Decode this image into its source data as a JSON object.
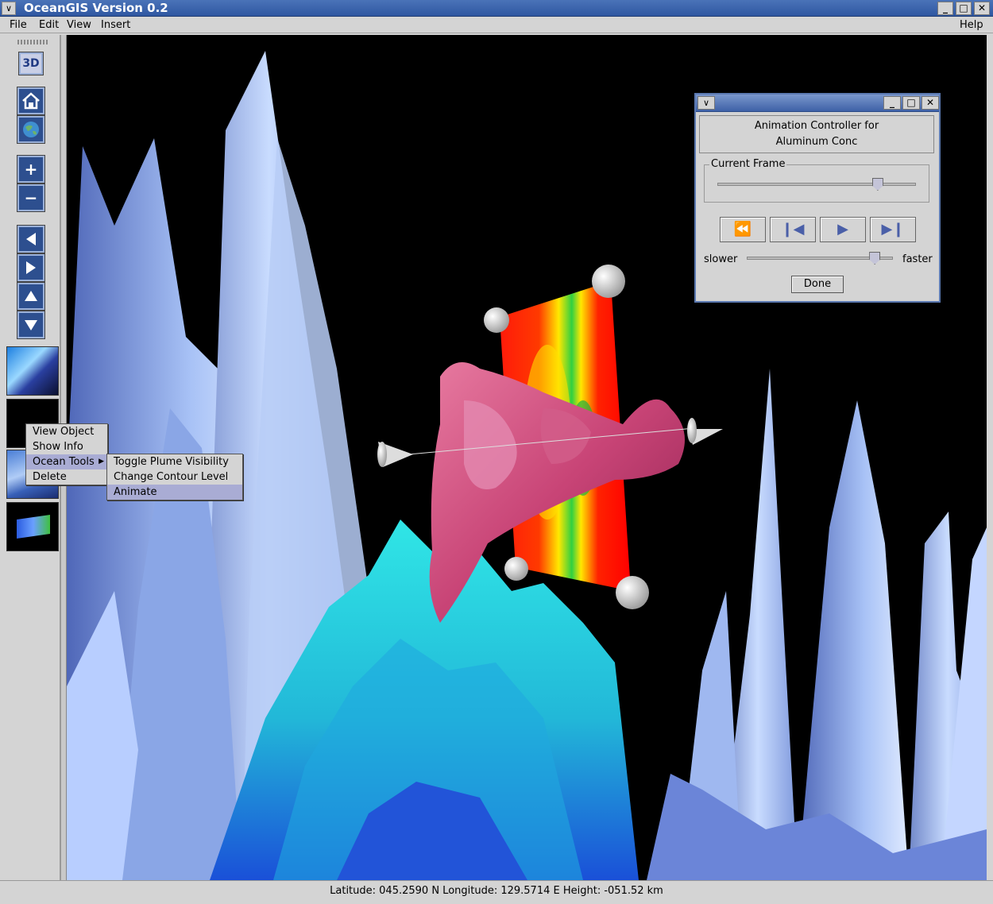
{
  "window": {
    "title": "OceanGIS Version 0.2",
    "sysmenu": "∨",
    "minimize": "_",
    "maximize": "□",
    "close": "✕"
  },
  "menubar": {
    "file": "File",
    "edit": "Edit",
    "view": "View",
    "insert": "Insert",
    "help": "Help"
  },
  "toolbar": {
    "three_d": "3D",
    "icons": [
      "home-icon",
      "globe-icon",
      "zoom-in-icon",
      "zoom-out-icon",
      "pan-left-icon",
      "pan-right-icon",
      "pan-up-icon",
      "pan-down-icon"
    ]
  },
  "context_menu": {
    "items": [
      "View Object",
      "Show Info",
      "Ocean Tools",
      "Delete"
    ],
    "selected": "Ocean Tools"
  },
  "submenu": {
    "items": [
      "Toggle Plume Visibility",
      "Change Contour Level",
      "Animate"
    ],
    "selected": "Animate"
  },
  "dialog": {
    "heading_line1": "Animation Controller for",
    "heading_line2": "Aluminum Conc",
    "current_frame_label": "Current Frame",
    "current_frame_position": 0.81,
    "slower_label": "slower",
    "faster_label": "faster",
    "speed_position": 0.88,
    "done_label": "Done",
    "playback_icons": [
      "rewind-icon",
      "step-back-icon",
      "play-icon",
      "step-forward-icon"
    ]
  },
  "status": {
    "text": "Latitude: 045.2590 N Longitude: 129.5714 E Height: -051.52 km"
  },
  "colors": {
    "titlebar": "#2f57a1",
    "menu_highlight": "#a9acd4",
    "viewport_bg": "#000000",
    "plume": "#c0456f",
    "terrain": "#a9c4f0",
    "seafloor": "#1fd0d8"
  }
}
